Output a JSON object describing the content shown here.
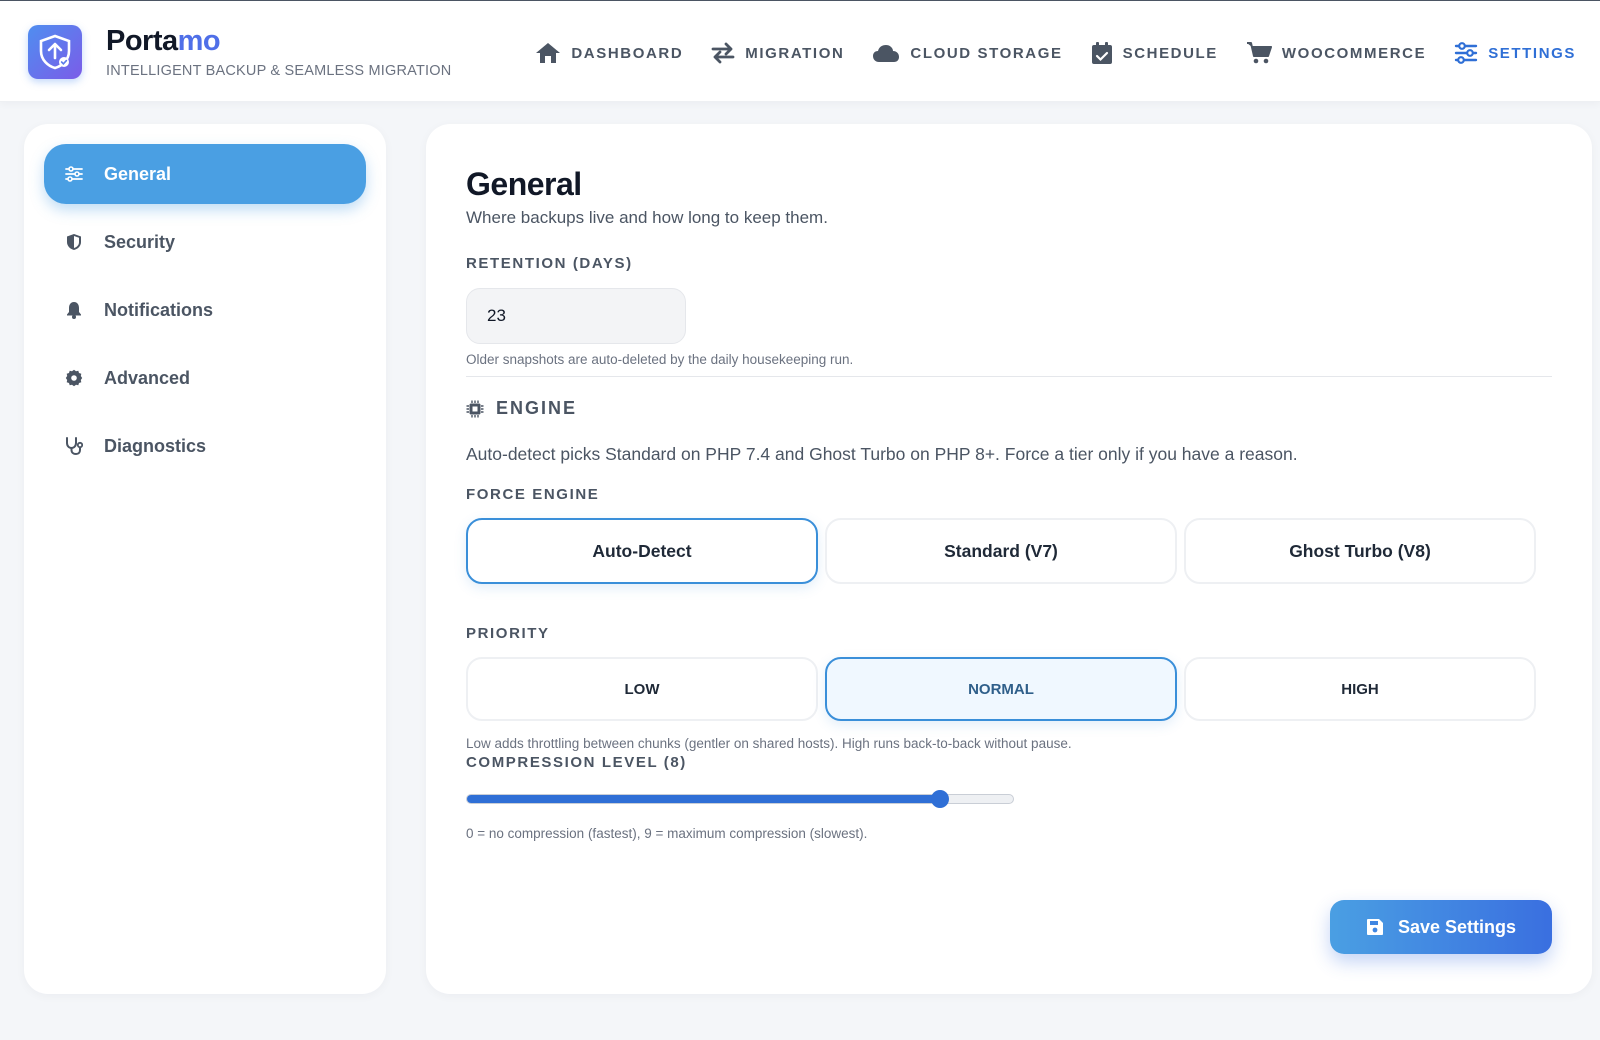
{
  "brand": {
    "name_main": "Porta",
    "name_accent": "mo",
    "tagline": "INTELLIGENT BACKUP & SEAMLESS MIGRATION",
    "icon": "shield-upload-icon"
  },
  "nav": {
    "items": [
      {
        "label": "DASHBOARD",
        "icon": "home-icon"
      },
      {
        "label": "MIGRATION",
        "icon": "swap-arrows-icon"
      },
      {
        "label": "CLOUD STORAGE",
        "icon": "cloud-icon"
      },
      {
        "label": "SCHEDULE",
        "icon": "calendar-check-icon"
      },
      {
        "label": "WOOCOMMERCE",
        "icon": "cart-icon"
      },
      {
        "label": "SETTINGS",
        "icon": "sliders-icon",
        "active": true
      }
    ]
  },
  "sidebar": {
    "items": [
      {
        "label": "General",
        "icon": "sliders-icon",
        "active": true
      },
      {
        "label": "Security",
        "icon": "shield-icon"
      },
      {
        "label": "Notifications",
        "icon": "bell-icon"
      },
      {
        "label": "Advanced",
        "icon": "gear-icon"
      },
      {
        "label": "Diagnostics",
        "icon": "stethoscope-icon"
      }
    ]
  },
  "main": {
    "title": "General",
    "subtitle": "Where backups live and how long to keep them.",
    "retention": {
      "label": "RETENTION (DAYS)",
      "value": "23",
      "hint": "Older snapshots are auto-deleted by the daily housekeeping run."
    },
    "engine": {
      "heading": "ENGINE",
      "icon": "chip-icon",
      "description": "Auto-detect picks Standard on PHP 7.4 and Ghost Turbo on PHP 8+. Force a tier only if you have a reason.",
      "force_label": "FORCE ENGINE",
      "options": [
        "Auto-Detect",
        "Standard (V7)",
        "Ghost Turbo (V8)"
      ],
      "selected": "Auto-Detect"
    },
    "priority": {
      "label": "PRIORITY",
      "options": [
        "LOW",
        "NORMAL",
        "HIGH"
      ],
      "selected": "NORMAL",
      "hint": "Low adds throttling between chunks (gentler on shared hosts). High runs back-to-back without pause."
    },
    "compression": {
      "label": "COMPRESSION LEVEL (8)",
      "value": 8,
      "min": 0,
      "max": 9,
      "hint": "0 = no compression (fastest), 9 = maximum compression (slowest)."
    },
    "save_label": "Save Settings",
    "save_icon": "floppy-disk-icon"
  },
  "colors": {
    "accent": "#4a9fe3",
    "nav_active": "#2f6fd6",
    "brand_accent": "#4f6fe8"
  }
}
